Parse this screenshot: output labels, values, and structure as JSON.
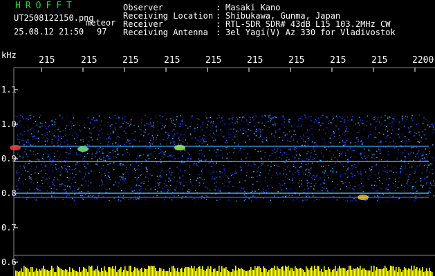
{
  "title": "HROFFT",
  "file_name": "UT2508122150.png",
  "meteor_label": "meteor",
  "date_time": "25.08.12 21:50",
  "count": "97",
  "header": [
    {
      "label": "Observer",
      "value": "Masaki Kano"
    },
    {
      "label": "Receiving Location",
      "value": "Shibukawa, Gunma, Japan"
    },
    {
      "label": "Receiver",
      "value": "RTL-SDR SDR# 43dB L15 103.2MHz CW"
    },
    {
      "label": "Receiving Antenna",
      "value": "3el Yagi(V) Az 330 for Vladivostok"
    }
  ],
  "axis_unit": "kHz",
  "time_ticks": [
    "215",
    "215",
    "215",
    "215",
    "215",
    "215",
    "215",
    "215",
    "215",
    "2200"
  ],
  "freq_ticks": [
    "1.1",
    "1.0",
    "0.9",
    "0.8",
    "0.7",
    "0.6"
  ],
  "colors": {
    "title": "#22dd22",
    "text": "#ffffff",
    "grid": "#888888",
    "signal": "#1a3cff",
    "bars": "#ffff00"
  }
}
